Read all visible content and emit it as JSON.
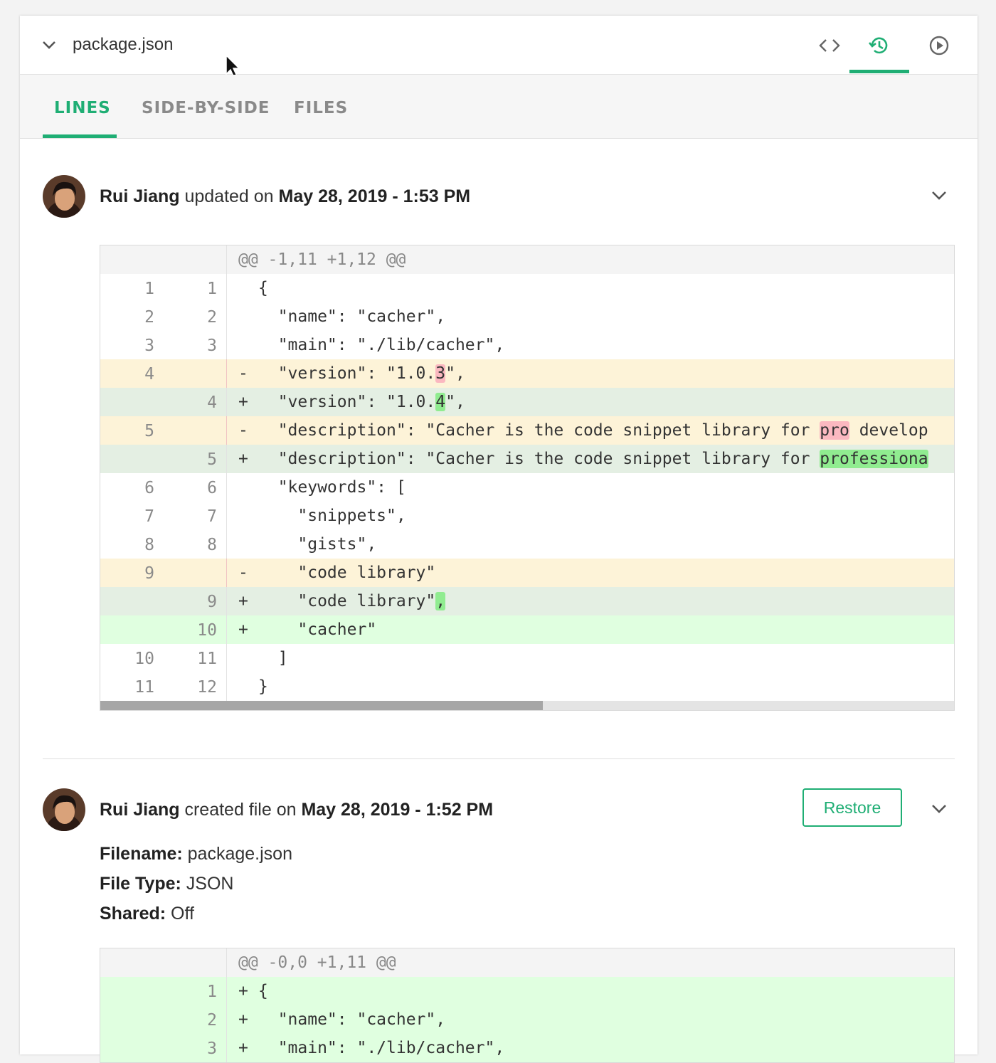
{
  "header": {
    "filename": "package.json",
    "icons": [
      "chevron-down-icon",
      "code-icon",
      "history-icon",
      "play-icon"
    ],
    "accent_color": "#1fae74"
  },
  "tabs": [
    {
      "label": "LINES",
      "active": true
    },
    {
      "label": "SIDE-BY-SIDE",
      "active": false
    },
    {
      "label": "FILES",
      "active": false
    }
  ],
  "entries": [
    {
      "author": "Rui Jiang",
      "action": " updated on ",
      "date": "May 28, 2019 - 1:53 PM",
      "diff": {
        "hunk": "@@ -1,11 +1,12 @@",
        "rows": [
          {
            "old": "1",
            "new": "1",
            "sign": " ",
            "text": "{"
          },
          {
            "old": "2",
            "new": "2",
            "sign": " ",
            "text": "  \"name\": \"cacher\","
          },
          {
            "old": "3",
            "new": "3",
            "sign": " ",
            "text": "  \"main\": \"./lib/cacher\","
          },
          {
            "old": "4",
            "new": "",
            "sign": "-",
            "pre": "  \"version\": \"1.0.",
            "hl": "3",
            "post": "\","
          },
          {
            "old": "",
            "new": "4",
            "sign": "+",
            "pre": "  \"version\": \"1.0.",
            "hl": "4",
            "post": "\","
          },
          {
            "old": "5",
            "new": "",
            "sign": "-",
            "pre": "  \"description\": \"Cacher is the code snippet library for ",
            "hl": "pro",
            "post": " develop"
          },
          {
            "old": "",
            "new": "5",
            "sign": "+",
            "pre": "  \"description\": \"Cacher is the code snippet library for ",
            "hl": "professiona",
            "post": ""
          },
          {
            "old": "6",
            "new": "6",
            "sign": " ",
            "text": "  \"keywords\": ["
          },
          {
            "old": "7",
            "new": "7",
            "sign": " ",
            "text": "    \"snippets\","
          },
          {
            "old": "8",
            "new": "8",
            "sign": " ",
            "text": "    \"gists\","
          },
          {
            "old": "9",
            "new": "",
            "sign": "-",
            "text": "    \"code library\""
          },
          {
            "old": "",
            "new": "9",
            "sign": "+",
            "pre": "    \"code library\"",
            "hl": ",",
            "post": ""
          },
          {
            "old": "",
            "new": "10",
            "sign": "+",
            "text": "    \"cacher\""
          },
          {
            "old": "10",
            "new": "11",
            "sign": " ",
            "text": "  ]"
          },
          {
            "old": "11",
            "new": "12",
            "sign": " ",
            "text": "}"
          }
        ]
      }
    },
    {
      "author": "Rui Jiang",
      "action": " created file on ",
      "date": "May 28, 2019 - 1:52 PM",
      "restore_label": "Restore",
      "meta": [
        {
          "label": "Filename:",
          "value": " package.json"
        },
        {
          "label": "File Type:",
          "value": " JSON"
        },
        {
          "label": "Shared:",
          "value": " Off"
        }
      ],
      "diff": {
        "hunk": "@@ -0,0 +1,11 @@",
        "rows": [
          {
            "old": "",
            "new": "1",
            "sign": "+",
            "text": "{"
          },
          {
            "old": "",
            "new": "2",
            "sign": "+",
            "text": "  \"name\": \"cacher\","
          },
          {
            "old": "",
            "new": "3",
            "sign": "+",
            "text": "  \"main\": \"./lib/cacher\","
          }
        ]
      }
    }
  ]
}
